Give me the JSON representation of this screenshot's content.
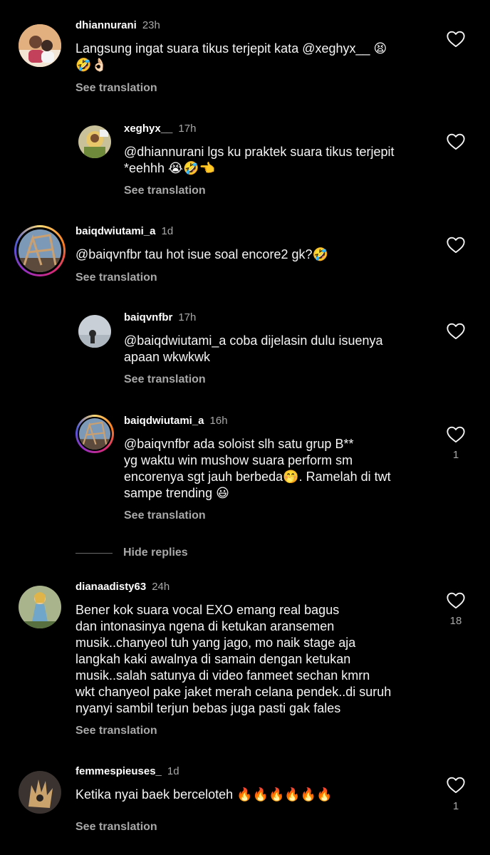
{
  "comments": [
    {
      "username": "dhiannurani",
      "time": "23h",
      "text": "Langsung ingat suara tikus terjepit kata @xeghyx__ 😫\n🤣👌🏻",
      "translation_label": "See translation"
    },
    {
      "username": "xeghyx__",
      "time": "17h",
      "text": "@dhiannurani lgs ku praktek suara tikus terjepit\n*eehhh 😭🤣👈",
      "translation_label": "See translation"
    },
    {
      "username": "baiqdwiutami_a",
      "time": "1d",
      "text": "@baiqvnfbr tau hot isue soal encore2 gk?🤣",
      "translation_label": "See translation"
    },
    {
      "username": "baiqvnfbr",
      "time": "17h",
      "text": "@baiqdwiutami_a coba dijelasin dulu isuenya\napaan wkwkwk",
      "translation_label": "See translation"
    },
    {
      "username": "baiqdwiutami_a",
      "time": "16h",
      "text": "@baiqvnfbr ada soloist slh satu grup B**\nyg waktu win mushow suara perform sm\nencorenya sgt jauh berbeda🤭. Ramelah di twt\nsampe trending 😃",
      "translation_label": "See translation",
      "likes": "1"
    },
    {
      "username": "dianaadisty63",
      "time": "24h",
      "text": "Bener kok suara vocal EXO emang real bagus\ndan intonasinya ngena di ketukan aransemen\nmusik..chanyeol tuh yang jago, mo naik stage aja\nlangkah kaki awalnya di samain dengan ketukan\nmusik..salah satunya di video fanmeet sechan kmrn\nwkt chanyeol pake jaket merah celana pendek..di suruh\nnyanyi sambil terjun bebas juga pasti gak fales",
      "translation_label": "See translation",
      "likes": "18"
    },
    {
      "username": "femmespieuses_",
      "time": "1d",
      "text": "Ketika nyai baek berceloteh 🔥🔥🔥🔥🔥🔥",
      "translation_label": "See translation",
      "likes": "1"
    }
  ],
  "hide_replies_label": "Hide replies",
  "icons": {
    "like": "heart-outline-icon"
  },
  "colors": {
    "background": "#000000",
    "text": "#f5f5f5",
    "secondary": "#a8a8a8"
  }
}
